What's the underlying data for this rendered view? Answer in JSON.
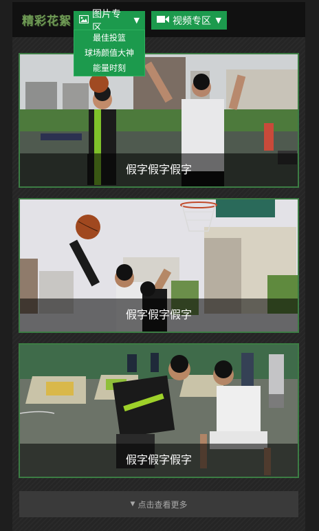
{
  "header": {
    "logo_text": "精彩花絮",
    "photo_menu": {
      "label": "图片专区",
      "icon": "image-icon",
      "items": [
        "最佳投篮",
        "球场颜值大神",
        "能量时刻"
      ]
    },
    "video_menu": {
      "label": "视频专区",
      "icon": "video-camera-icon"
    }
  },
  "gallery": {
    "cards": [
      {
        "caption": "假字假字假字"
      },
      {
        "caption": "假字假字假字"
      },
      {
        "caption": "假字假字假字"
      }
    ]
  },
  "load_more": {
    "label": "点击查看更多"
  },
  "colors": {
    "accent_green": "#1c9a4d",
    "card_border": "#3c7d44",
    "logo_green": "#6f9a55",
    "background": "#1e1e1e"
  }
}
